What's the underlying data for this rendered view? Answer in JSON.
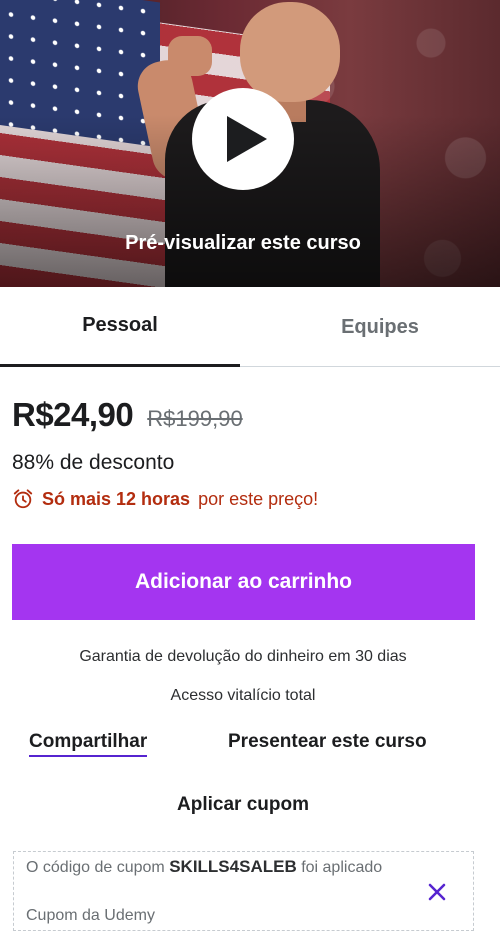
{
  "preview": {
    "label": "Pré-visualizar este curso",
    "play_icon": "play-icon"
  },
  "tabs": [
    {
      "label": "Pessoal",
      "active": true
    },
    {
      "label": "Equipes",
      "active": false
    }
  ],
  "pricing": {
    "current_price": "R$24,90",
    "original_price": "R$199,90",
    "discount_text": "88% de desconto",
    "urgency_icon": "alarm-clock-icon",
    "urgency_bold": "Só mais 12 horas",
    "urgency_rest": "por este preço!"
  },
  "actions": {
    "add_to_cart": "Adicionar ao carrinho",
    "guarantee": "Garantia de devolução do dinheiro em 30 dias",
    "lifetime_access": "Acesso vitalício total",
    "share": "Compartilhar",
    "gift": "Presentear este curso",
    "apply_coupon": "Aplicar cupom"
  },
  "coupon": {
    "prefix": "O código de cupom",
    "code": "SKILLS4SALEB",
    "suffix": "foi aplicado",
    "source": "Cupom da Udemy",
    "remove_icon": "close-icon"
  },
  "colors": {
    "accent": "#a435f0",
    "urgency": "#b32d0f",
    "underline": "#5624d0"
  }
}
